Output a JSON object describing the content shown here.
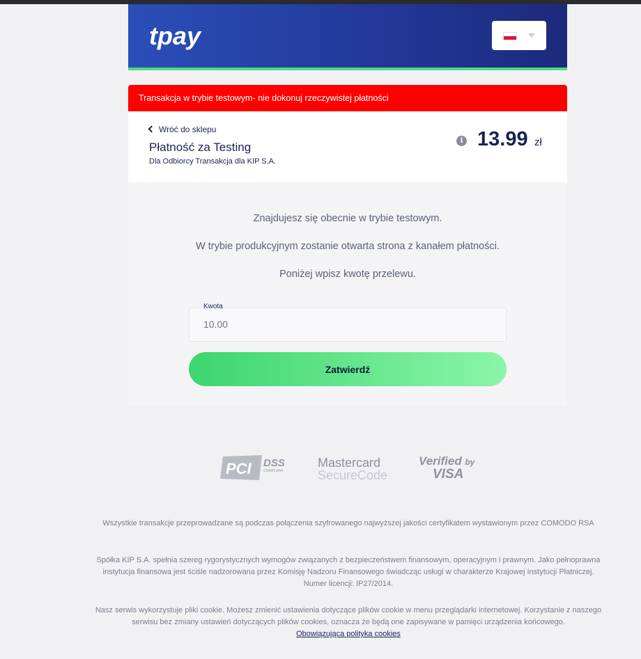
{
  "header": {
    "logo_text": "tpay",
    "language_flag": "flag-pl",
    "accent_color": "#4cd886"
  },
  "alert": {
    "text": "Transakcja w trybie testowym- nie dokonuj rzeczywistej płatności",
    "color": "#ff0000"
  },
  "summary": {
    "back_label": "Wróć do sklepu",
    "title": "Płatność za Testing",
    "recipient": "Dla Odbiorcy Transakcja dla KIP S.A.",
    "amount": "13.99",
    "currency": "zł",
    "info_icon": "i"
  },
  "test_mode": {
    "line1": "Znajdujesz się obecnie w trybie testowym.",
    "line2": "W trybie produkcyjnym zostanie otwarta strona z kanałem płatności.",
    "line3": "Poniżej wpisz kwotę przelewu."
  },
  "form": {
    "amount_label": "Kwota",
    "amount_placeholder": "10.00",
    "submit_label": "Zatwierdź"
  },
  "badges": {
    "pci_letters": "PCI",
    "pci_dss": "DSS",
    "pci_compliant": "COMPLIANT",
    "mastercard_line1": "Mastercard",
    "mastercard_line2": "SecureCode",
    "visa_line1": "Verified",
    "visa_by": "by",
    "visa_line2": "VISA"
  },
  "footer": {
    "para1": "Wszystkie transakcje przeprowadzane są podczas połączenia szyfrowanego najwyższej jakości certyfikatem wystawionym przez COMODO RSA",
    "para2": "Spółka KIP S.A. spełnia szereg rygorystycznych wymogów związanych z bezpieczeństwem finansowym, operacyjnym i prawnym. Jako pełnoprawna instytucja finansowa jest ściśle nadzorowana przez Komisję Nadzoru Finansowego świadcząc usługi w charakterze Krajowej Instytucji Płatniczej. Numer licencji: IP27/2014.",
    "para3": "Nasz serwis wykorzystuje pliki cookie. Możesz zmienić ustawienia dotyczące plików cookie w menu przeglądarki internetowej. Korzystanie z naszego serwisu bez zmiany ustawień dotyczących plików cookies, oznacza że będą one zapisywane w pamięci urządzenia końcowego.",
    "cookie_link": "Obowiązująca polityka cookies"
  }
}
